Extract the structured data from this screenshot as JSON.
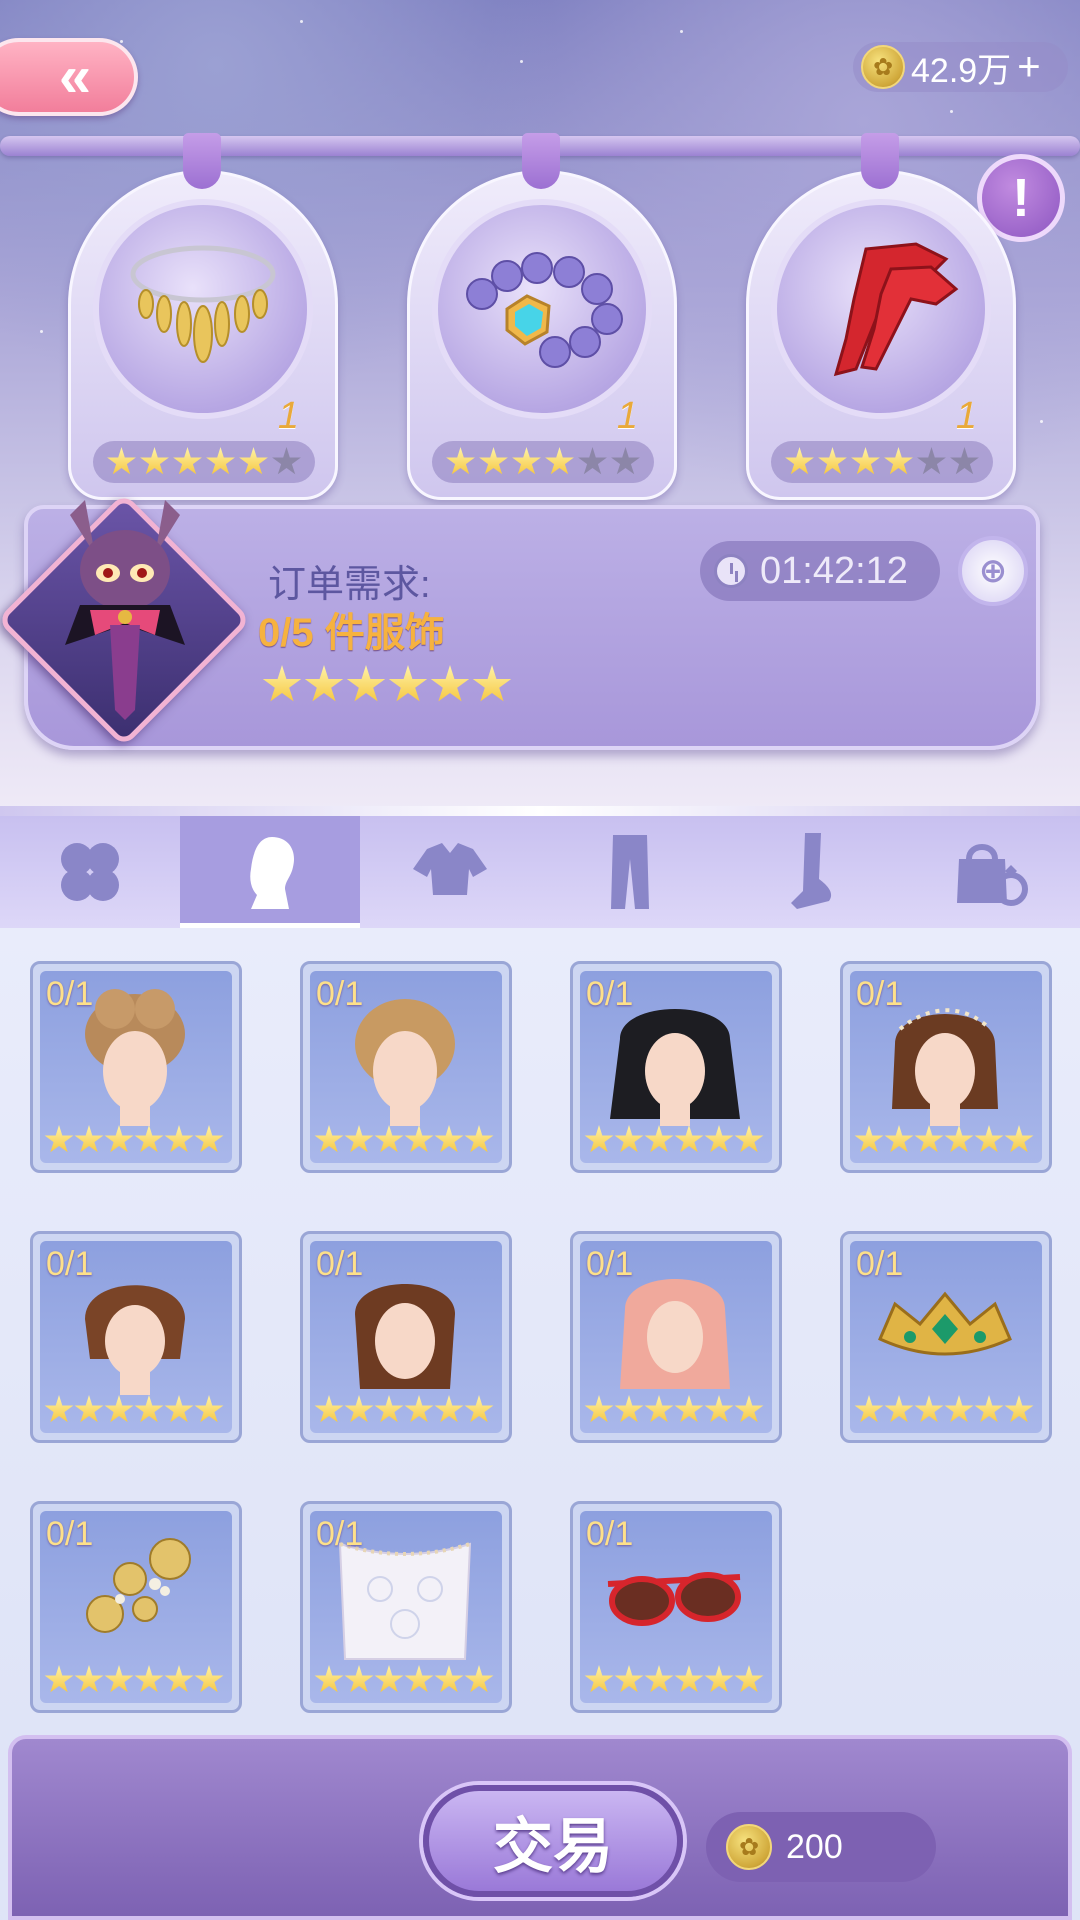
{
  "header": {
    "back_label": "«",
    "coins": "42.9万",
    "coins_plus": "+",
    "info_label": "!"
  },
  "requested_items": [
    {
      "name": "necklace",
      "count": "1",
      "stars_on": 5,
      "stars_total": 6
    },
    {
      "name": "gem-bracelet",
      "count": "1",
      "stars_on": 4,
      "stars_total": 6
    },
    {
      "name": "red-gloves",
      "count": "1",
      "stars_on": 4,
      "stars_total": 6
    }
  ],
  "order": {
    "title": "订单需求:",
    "requirement": "0/5 件服饰",
    "stars": 6,
    "timer": "01:42:12"
  },
  "tabs": [
    {
      "name": "all",
      "icon": "clover-icon"
    },
    {
      "name": "hair",
      "icon": "head-silhouette-icon",
      "active": true
    },
    {
      "name": "tops",
      "icon": "top-icon"
    },
    {
      "name": "bottoms",
      "icon": "pants-icon"
    },
    {
      "name": "shoes",
      "icon": "foot-icon"
    },
    {
      "name": "accessories",
      "icon": "bag-ring-icon"
    }
  ],
  "items": [
    {
      "count": "0/1",
      "kind": "light-brown-updo"
    },
    {
      "count": "0/1",
      "kind": "blonde-braid"
    },
    {
      "count": "0/1",
      "kind": "black-long-hair"
    },
    {
      "count": "0/1",
      "kind": "brown-curly-headband"
    },
    {
      "count": "0/1",
      "kind": "brown-bob"
    },
    {
      "count": "0/1",
      "kind": "brown-braids"
    },
    {
      "count": "0/1",
      "kind": "pink-long-hair"
    },
    {
      "count": "0/1",
      "kind": "gold-crown"
    },
    {
      "count": "0/1",
      "kind": "gold-flower-hairpin"
    },
    {
      "count": "0/1",
      "kind": "lace-veil"
    },
    {
      "count": "0/1",
      "kind": "red-sunglasses"
    }
  ],
  "footer": {
    "trade_label": "交易",
    "price": "200"
  },
  "colors": {
    "accent_purple": "#a79de0",
    "star_gold": "#f5c43a",
    "count_gold": "#f6b23f"
  }
}
